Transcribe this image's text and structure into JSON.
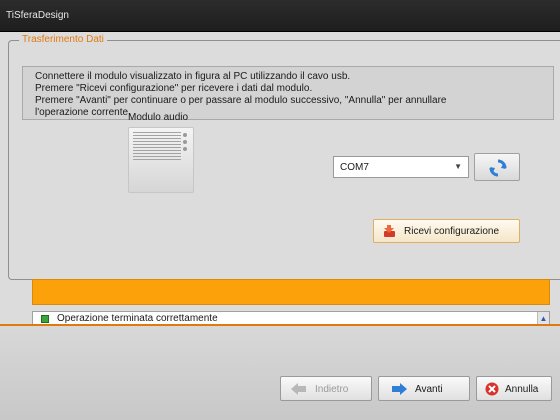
{
  "window": {
    "title": "TiSferaDesign"
  },
  "section": {
    "title": "Trasferimento Dati"
  },
  "instructions": {
    "line1": "Connettere il modulo visualizzato in figura al PC utilizzando il cavo usb.",
    "line2": "Premere \"Ricevi configurazione\" per ricevere i dati dal modulo.",
    "line3": "Premere \"Avanti\" per continuare o per passare al modulo successivo, \"Annulla\" per annullare",
    "line4": "l'operazione corrente."
  },
  "module": {
    "label": "Modulo audio",
    "icon": "audio-module-image"
  },
  "port": {
    "selected": "COM7"
  },
  "buttons": {
    "refresh_icon": "refresh-icon",
    "receive_label": "Ricevi configurazione",
    "back_label": "Indietro",
    "next_label": "Avanti",
    "cancel_label": "Annulla"
  },
  "progress": {
    "value": 1.0,
    "color": "#fda10a"
  },
  "status": {
    "message": "Operazione terminata correttamente",
    "indicator_color": "#3aa63a"
  },
  "colors": {
    "accent": "#e07a10",
    "titlebar": "#2c2c2c"
  }
}
